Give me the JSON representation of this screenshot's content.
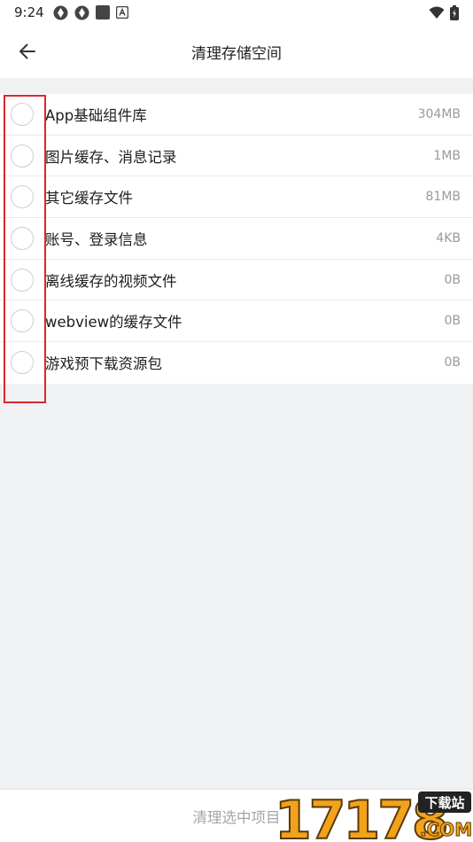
{
  "status_bar": {
    "time": "9:24"
  },
  "header": {
    "title": "清理存储空间",
    "back_icon": "arrow-left-icon"
  },
  "items": [
    {
      "label": "App基础组件库",
      "size": "304MB"
    },
    {
      "label": "图片缓存、消息记录",
      "size": "1MB"
    },
    {
      "label": "其它缓存文件",
      "size": "81MB"
    },
    {
      "label": "账号、登录信息",
      "size": "4KB"
    },
    {
      "label": "离线缓存的视频文件",
      "size": "0B"
    },
    {
      "label": "webview的缓存文件",
      "size": "0B"
    },
    {
      "label": "游戏预下载资源包",
      "size": "0B"
    }
  ],
  "bottom": {
    "button_label": "清理选中项目"
  },
  "watermark": {
    "number": "17178",
    "tag": "下载站",
    "domain": ".COM"
  },
  "colors": {
    "highlight": "#d8282a",
    "background": "#f0f1f3",
    "watermark_orange": "#f2a31b"
  }
}
